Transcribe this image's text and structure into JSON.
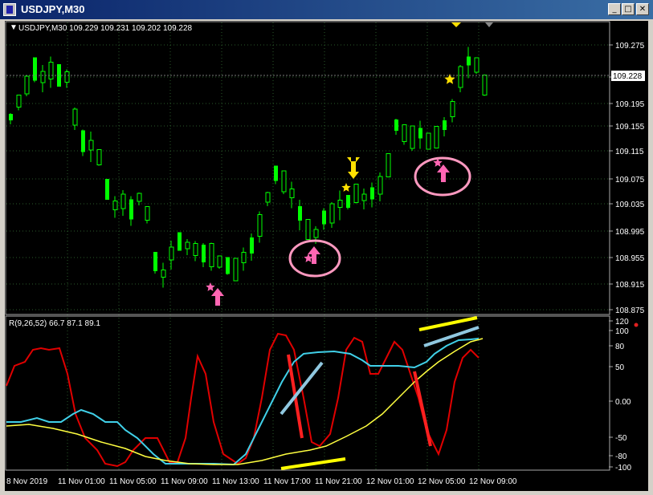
{
  "window": {
    "title": "USDJPY,M30",
    "minimize_glyph": "_",
    "maximize_glyph": "□",
    "close_glyph": "✕"
  },
  "chart": {
    "header": "USDJPY,M30  109.229 109.231 109.202 109.228",
    "current_price_label": "109.228",
    "price_ticks": [
      "109.275",
      "109.235",
      "109.195",
      "109.155",
      "109.115",
      "109.075",
      "109.035",
      "108.995",
      "108.955",
      "108.915",
      "108.875"
    ],
    "time_ticks": [
      "8 Nov 2019",
      "11 Nov 01:00",
      "11 Nov 05:00",
      "11 Nov 09:00",
      "11 Nov 13:00",
      "11 Nov 17:00",
      "11 Nov 21:00",
      "12 Nov 01:00",
      "12 Nov 05:00",
      "12 Nov 09:00"
    ]
  },
  "indicator": {
    "label": "R(9,26,52) 66.7 87.1 89.1",
    "ticks": [
      "120",
      "100",
      "80",
      "50",
      "0.00",
      "-50",
      "-80",
      "-100"
    ]
  },
  "colors": {
    "candle": "#00ff00",
    "grid": "#2a5a2a",
    "red_line": "#e00000",
    "cyan_line": "#40d0e8",
    "yellow_line": "#ffff40",
    "signal_arrow": "#ff66b3",
    "circle": "#ff99c0",
    "star": "#ffe000",
    "drawn_red": "#ff2020",
    "drawn_blue": "#90c8e0",
    "drawn_yellow": "#ffff00"
  }
}
